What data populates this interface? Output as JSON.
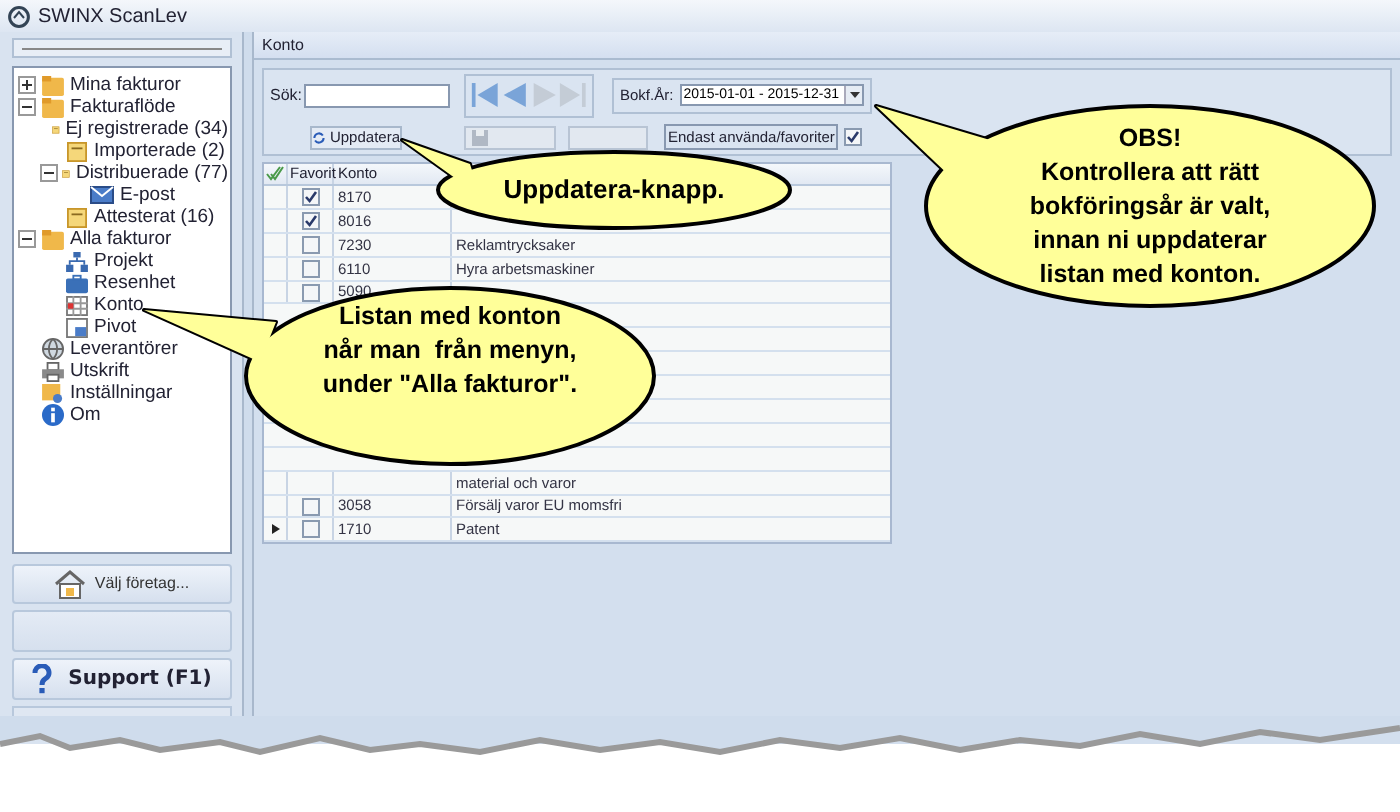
{
  "window": {
    "title": "SWINX ScanLev"
  },
  "sidebar": {
    "tree": [
      {
        "label": "Mina fakturor",
        "kind": "folder",
        "expanded": false
      },
      {
        "label": "Fakturaflöde",
        "kind": "folder",
        "expanded": true,
        "children": [
          {
            "label": "Ej registrerade (34)",
            "kind": "doc"
          },
          {
            "label": "Importerade (2)",
            "kind": "doc"
          },
          {
            "label": "Distribuerade (77)",
            "kind": "doc",
            "expanded": true,
            "children": [
              {
                "label": "E-post",
                "kind": "mail"
              }
            ]
          },
          {
            "label": "Attesterat (16)",
            "kind": "doc"
          }
        ]
      },
      {
        "label": "Alla fakturor",
        "kind": "folder",
        "expanded": true,
        "children": [
          {
            "label": "Projekt",
            "kind": "org"
          },
          {
            "label": "Resenhet",
            "kind": "case"
          },
          {
            "label": "Konto",
            "kind": "table"
          },
          {
            "label": "Pivot",
            "kind": "pivot"
          }
        ]
      },
      {
        "label": "Leverantörer",
        "kind": "globe"
      },
      {
        "label": "Utskrift",
        "kind": "printer"
      },
      {
        "label": "Inställningar",
        "kind": "settings"
      },
      {
        "label": "Om",
        "kind": "info"
      }
    ],
    "buttons": [
      {
        "label": "Välj företag...",
        "kind": "company"
      },
      {
        "kind": "blank"
      },
      {
        "label": "Support (F1)",
        "kind": "support"
      }
    ]
  },
  "panel": {
    "title": "Konto",
    "search": {
      "label": "Sök:"
    },
    "update_button": "Uppdatera",
    "year": {
      "label": "Bokf.År:",
      "value": "2015-01-01 - 2015-12-31"
    },
    "only_used": {
      "label": "Endast använda/favoriter",
      "checked": true
    }
  },
  "table": {
    "columns": [
      "Favorit",
      "Konto"
    ],
    "rows": [
      {
        "kind": "account",
        "favorite": true,
        "konto": "8170"
      },
      {
        "kind": "account",
        "favorite": true,
        "konto": "8016"
      },
      {
        "kind": "account",
        "favorite": false,
        "konto": "7230",
        "name": "Reklamtrycksaker"
      },
      {
        "kind": "account",
        "favorite": false,
        "konto": "6110",
        "name": "Hyra arbetsmaskiner"
      },
      {
        "kind": "account",
        "favorite": false,
        "konto": "5090"
      },
      {
        "kind": "covered"
      },
      {
        "kind": "covered"
      },
      {
        "kind": "covered"
      },
      {
        "kind": "covered"
      },
      {
        "kind": "covered"
      },
      {
        "kind": "covered"
      },
      {
        "kind": "covered"
      },
      {
        "kind": "account",
        "name": "material och varor"
      },
      {
        "kind": "account",
        "favorite": false,
        "konto": "3058",
        "name": "Försälj varor EU momsfri"
      },
      {
        "kind": "account",
        "favorite": false,
        "konto": "1710",
        "name": "Patent",
        "current": true
      }
    ]
  },
  "callouts": [
    {
      "kind": "update",
      "text": "Uppdatera-knapp."
    },
    {
      "kind": "list",
      "lines": [
        "Listan med konton",
        "når man  från menyn,",
        "under \"Alla fakturor\"."
      ]
    },
    {
      "kind": "year",
      "lines": [
        "OBS!",
        "Kontrollera att rätt",
        "bokföringsår är valt,",
        "innan ni uppdaterar",
        "listan med konton."
      ]
    }
  ]
}
